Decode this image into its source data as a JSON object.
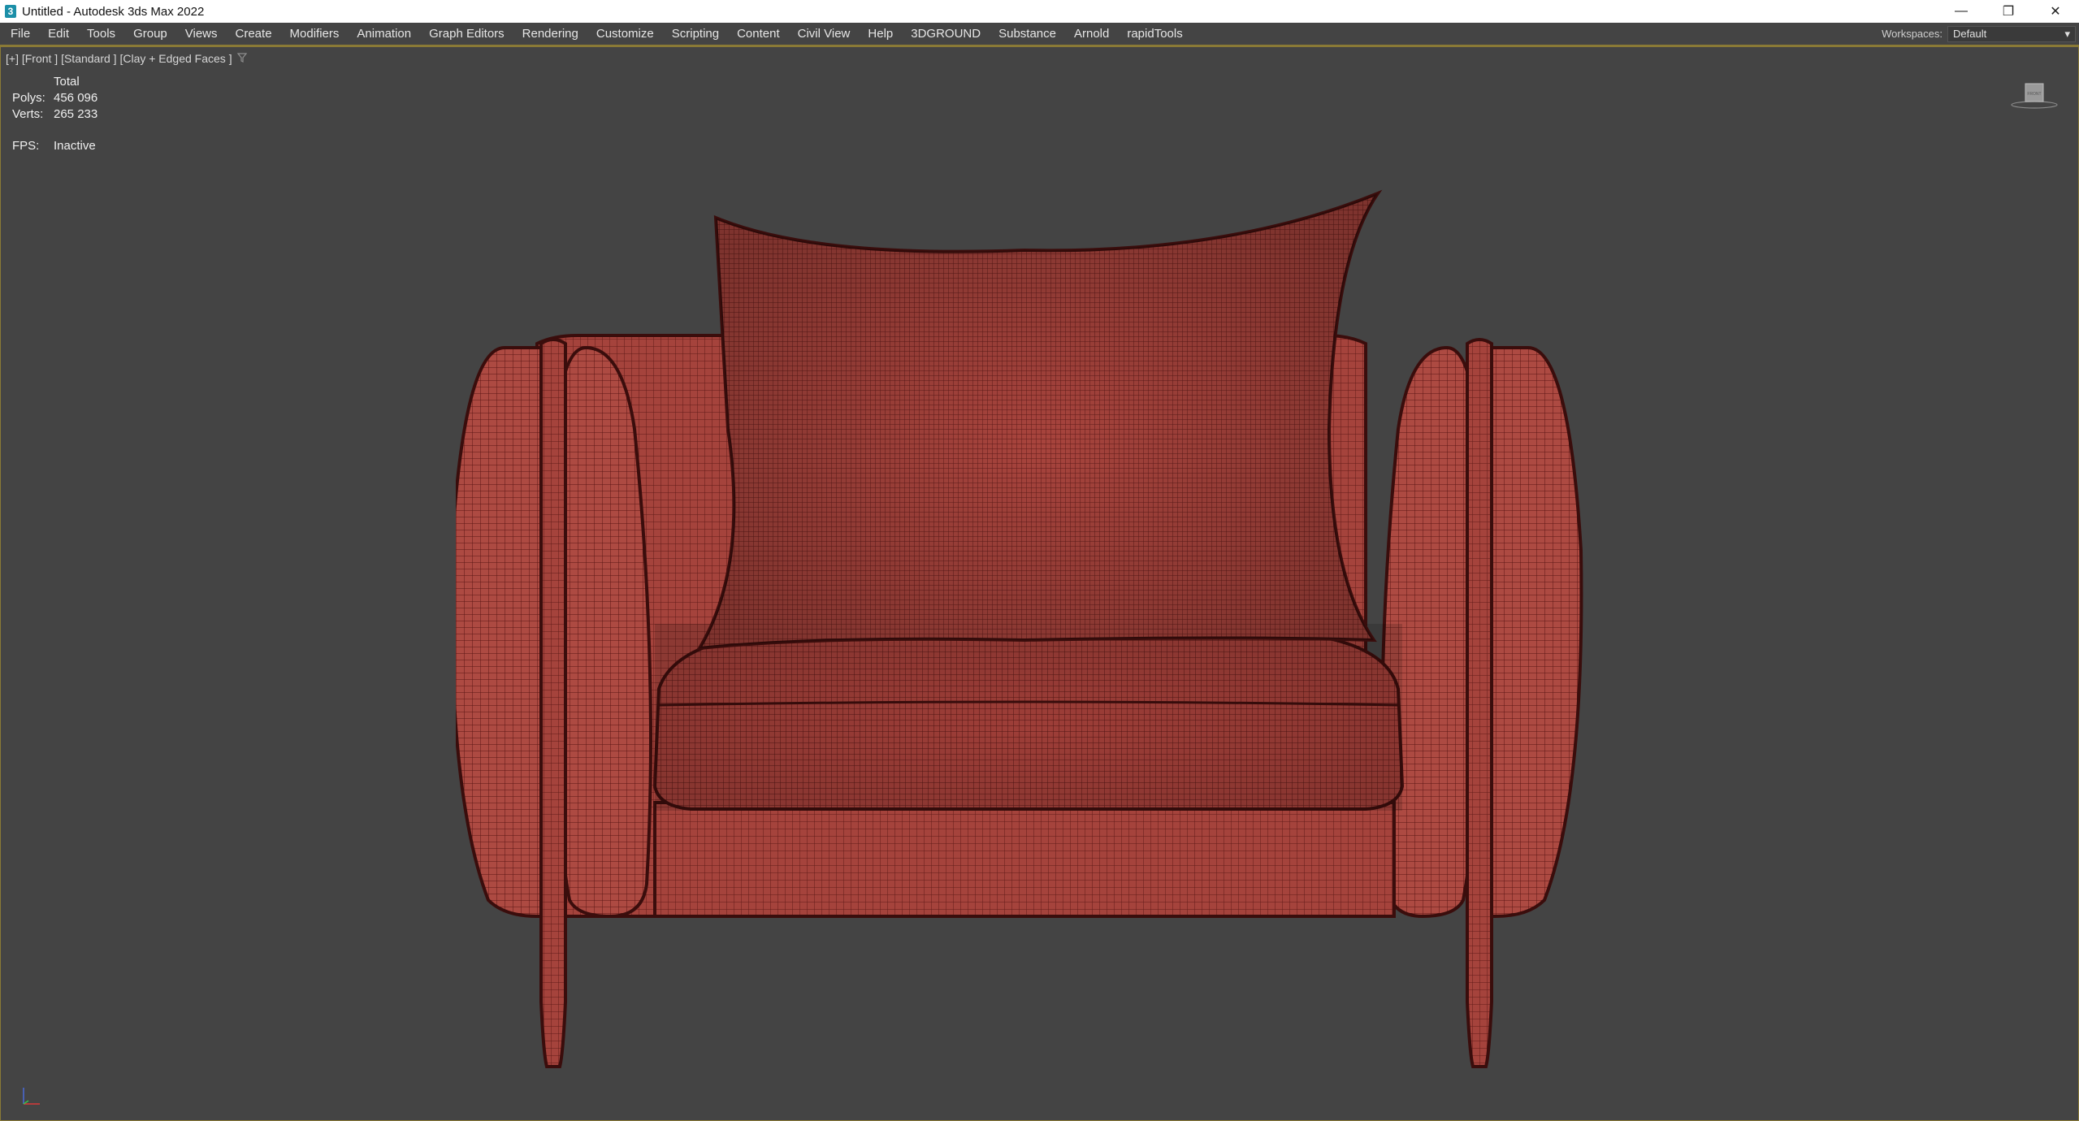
{
  "window": {
    "title": "Untitled - Autodesk 3ds Max 2022",
    "app_icon": "3",
    "controls": {
      "minimize": "—",
      "restore": "❐",
      "close": "✕"
    }
  },
  "menu": {
    "items": [
      "File",
      "Edit",
      "Tools",
      "Group",
      "Views",
      "Create",
      "Modifiers",
      "Animation",
      "Graph Editors",
      "Rendering",
      "Customize",
      "Scripting",
      "Content",
      "Civil View",
      "Help",
      "3DGROUND",
      "Substance",
      "Arnold",
      "rapidTools"
    ],
    "workspaces_label": "Workspaces:",
    "workspaces_value": "Default"
  },
  "viewport": {
    "label": "[+] [Front ] [Standard ] [Clay + Edged Faces ]",
    "filter_icon": "filter-icon",
    "viewcube_label": "FRONT",
    "stats": {
      "header": "Total",
      "polys_label": "Polys:",
      "polys_value": "456 096",
      "verts_label": "Verts:",
      "verts_value": "265 233",
      "fps_label": "FPS:",
      "fps_value": "Inactive"
    }
  },
  "colors": {
    "viewport_bg": "#444444",
    "menu_accent": "#8a7a36",
    "mesh_fill": "#a5433c",
    "mesh_wire": "#5a1614"
  }
}
